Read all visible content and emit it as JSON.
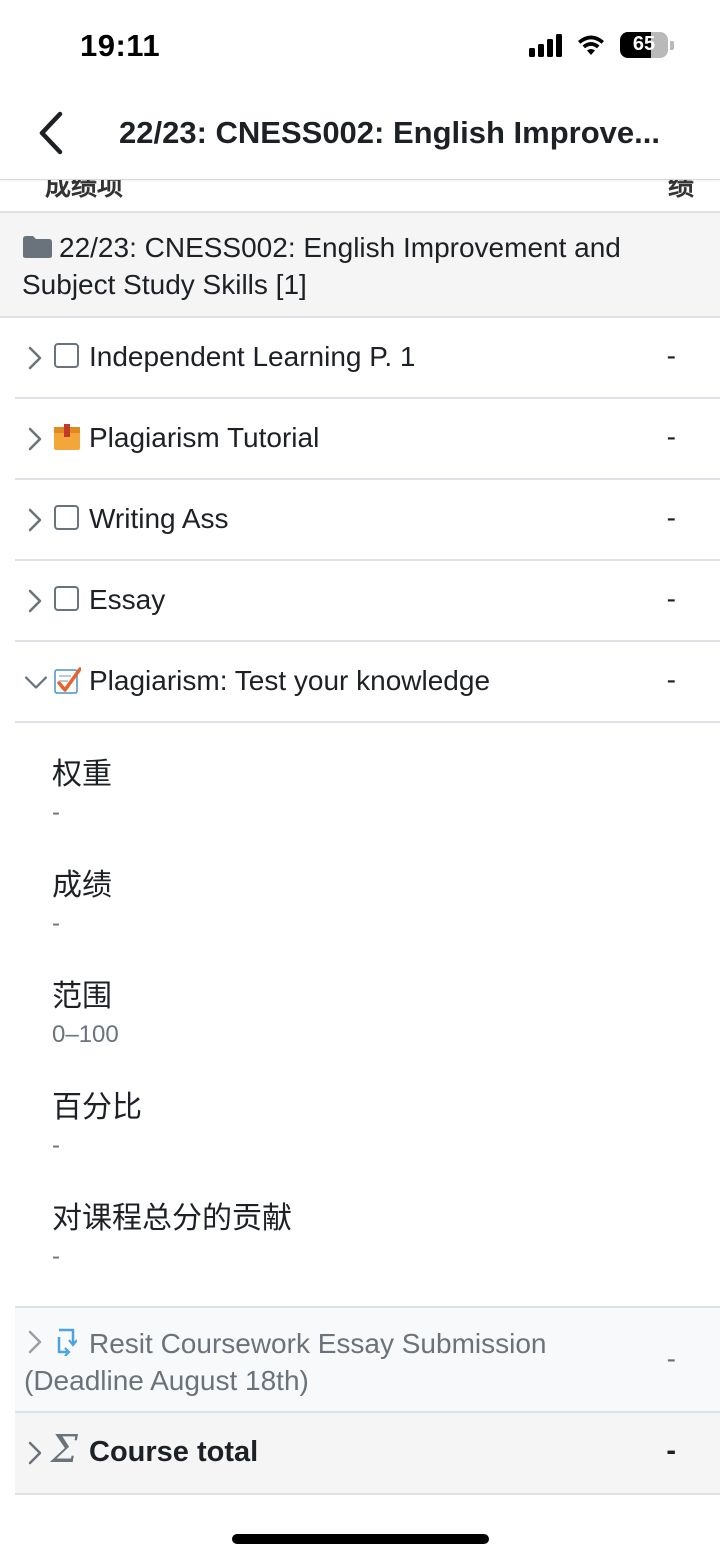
{
  "status_bar": {
    "time": "19:11",
    "battery_percent": "65",
    "battery_level": 0.65
  },
  "nav": {
    "title": "22/23: CNESS002: English Improve..."
  },
  "table_header": {
    "item_col": "成绩项",
    "grade_col": "绩"
  },
  "category": {
    "icon": "folder-icon",
    "name": "22/23: CNESS002: English Improvement and Subject Study Skills [1]"
  },
  "items": [
    {
      "label": "Independent Learning P. 1",
      "grade": "-",
      "icon": "checkbox-icon"
    },
    {
      "label": "Plagiarism Tutorial",
      "grade": "-",
      "icon": "package-icon"
    },
    {
      "label": "Writing Ass",
      "grade": "-",
      "icon": "checkbox-icon"
    },
    {
      "label": "Essay",
      "grade": "-",
      "icon": "checkbox-icon"
    },
    {
      "label": "Plagiarism: Test your knowledge",
      "grade": "-",
      "icon": "quiz-icon",
      "expanded": true
    }
  ],
  "details": [
    {
      "label": "权重",
      "value": "-"
    },
    {
      "label": "成绩",
      "value": "-"
    },
    {
      "label": "范围",
      "value": "0–100"
    },
    {
      "label": "百分比",
      "value": "-"
    },
    {
      "label": "对课程总分的贡献",
      "value": "-"
    }
  ],
  "resit": {
    "label": "Resit Coursework Essay Submission (Deadline August 18th)",
    "grade": "-",
    "icon": "resit-icon"
  },
  "total": {
    "icon": "sigma-icon",
    "symbol": "Σ",
    "label": "Course total",
    "grade": "-"
  },
  "colors": {
    "text": "#1d2125",
    "muted": "#6a737b",
    "border": "#dee2e6",
    "quiz_check": "#e8632a",
    "resit_icon": "#4aa3df",
    "package": "#f3a73b"
  }
}
